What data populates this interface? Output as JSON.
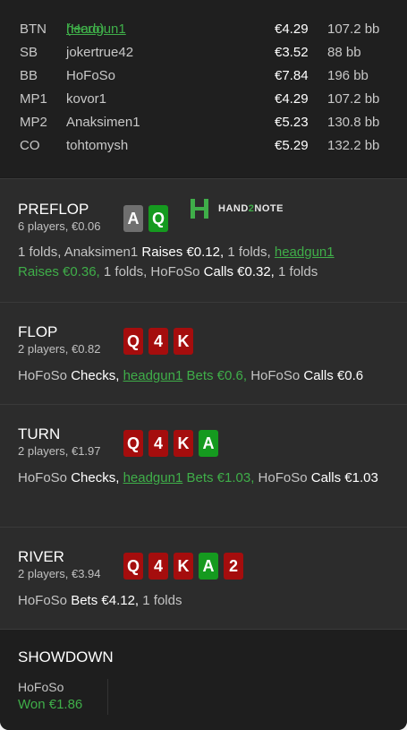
{
  "players": [
    {
      "pos": "BTN",
      "name": "headgun1",
      "hero_tag": "(Hero)",
      "amount": "€4.29",
      "bb": "107.2 bb"
    },
    {
      "pos": "SB",
      "name": "jokertrue42",
      "amount": "€3.52",
      "bb": "88 bb"
    },
    {
      "pos": "BB",
      "name": "HoFoSo",
      "amount": "€7.84",
      "bb": "196 bb"
    },
    {
      "pos": "MP1",
      "name": "kovor1",
      "amount": "€4.29",
      "bb": "107.2 bb"
    },
    {
      "pos": "MP2",
      "name": "Anaksimen1",
      "amount": "€5.23",
      "bb": "130.8 bb"
    },
    {
      "pos": "CO",
      "name": "tohtomysh",
      "amount": "€5.29",
      "bb": "132.2 bb"
    }
  ],
  "logo": {
    "left": "HAND",
    "mid": "2",
    "right": "NOTE"
  },
  "preflop": {
    "title": "PREFLOP",
    "sub": "6 players, €0.06",
    "cards": [
      {
        "rank": "A",
        "color": "grey"
      },
      {
        "rank": "Q",
        "color": "green"
      }
    ],
    "a1": "1 folds, Anaksimen1 ",
    "a2": "Raises €0.12,",
    "a3": " 1 folds, ",
    "a4": "headgun1",
    "a5": "Raises €0.36,",
    "a6": " 1 folds, HoFoSo ",
    "a7": "Calls €0.32,",
    "a8": " 1 folds"
  },
  "flop": {
    "title": "FLOP",
    "sub": "2 players, €0.82",
    "cards": [
      {
        "rank": "Q",
        "color": "red"
      },
      {
        "rank": "4",
        "color": "red"
      },
      {
        "rank": "K",
        "color": "red"
      }
    ],
    "a1": "HoFoSo ",
    "a2": "Checks,",
    "a3": "headgun1",
    "a4": " Bets €0.6,",
    "a5": " HoFoSo ",
    "a6": "Calls €0.6"
  },
  "turn": {
    "title": "TURN",
    "sub": "2 players, €1.97",
    "cards": [
      {
        "rank": "Q",
        "color": "red"
      },
      {
        "rank": "4",
        "color": "red"
      },
      {
        "rank": "K",
        "color": "red"
      },
      {
        "rank": "A",
        "color": "green"
      }
    ],
    "a1": "HoFoSo ",
    "a2": "Checks,",
    "a3": "headgun1",
    "a4": " Bets €1.03,",
    "a5": " HoFoSo ",
    "a6": "Calls €1.03"
  },
  "river": {
    "title": "RIVER",
    "sub": "2 players, €3.94",
    "cards": [
      {
        "rank": "Q",
        "color": "red"
      },
      {
        "rank": "4",
        "color": "red"
      },
      {
        "rank": "K",
        "color": "red"
      },
      {
        "rank": "A",
        "color": "green"
      },
      {
        "rank": "2",
        "color": "red"
      }
    ],
    "a1": "HoFoSo ",
    "a2": "Bets €4.12,",
    "a3": " 1 folds"
  },
  "showdown": {
    "title": "SHOWDOWN",
    "player": "HoFoSo",
    "won": "Won €1.86"
  },
  "colors": {
    "background": "#1b1b1b",
    "section": "#2c2c2c",
    "accent_green": "#3fae49",
    "card_red": "#a50d0d",
    "card_green": "#159a1f",
    "card_grey": "#6f6f6f"
  }
}
